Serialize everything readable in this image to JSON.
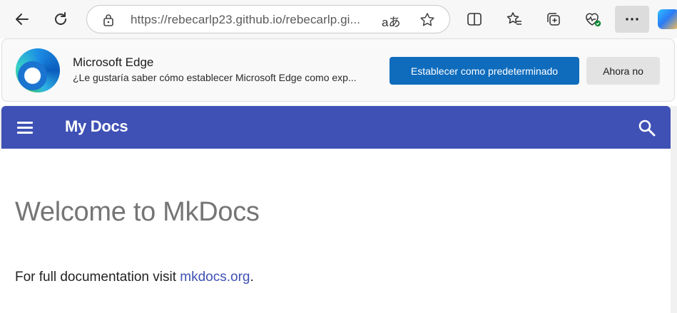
{
  "browser": {
    "url": "https://rebecarlp23.github.io/rebecarlp.gi...",
    "read_aloud_glyph": "aあ"
  },
  "infobar": {
    "title": "Microsoft Edge",
    "message": "¿Le gustaría saber cómo establecer Microsoft Edge como exp...",
    "primary_button": "Establecer como predeterminado",
    "secondary_button": "Ahora no",
    "accent_color": "#0f6cbd"
  },
  "site": {
    "title": "My Docs",
    "header_color": "#3f51b5"
  },
  "page": {
    "heading": "Welcome to MkDocs",
    "paragraph_prefix": "For full documentation visit ",
    "link_text": "mkdocs.org",
    "paragraph_suffix": "."
  },
  "icons": [
    "back-arrow-icon",
    "refresh-icon",
    "lock-icon",
    "read-aloud-icon",
    "favorite-star-icon",
    "split-screen-icon",
    "favorites-icon",
    "collections-icon",
    "browser-essentials-icon",
    "more-icon",
    "copilot-icon",
    "edge-logo-icon",
    "menu-icon",
    "search-icon"
  ]
}
